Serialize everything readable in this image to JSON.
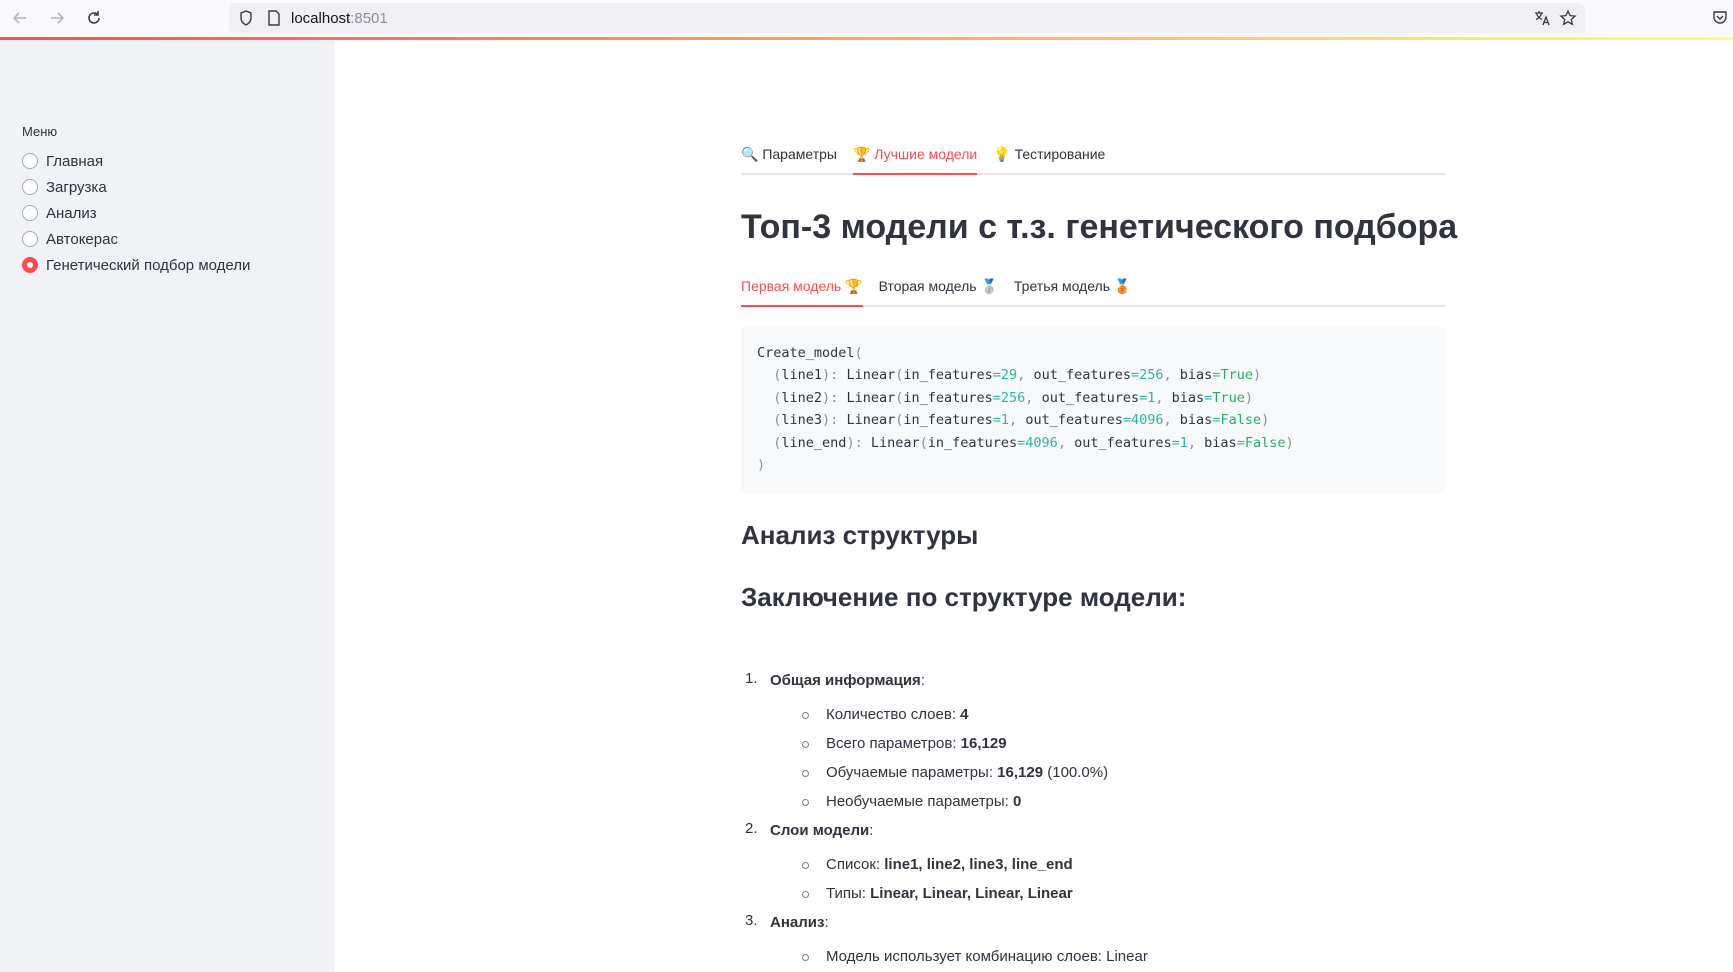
{
  "browser": {
    "url_host": "localhost",
    "url_port": ":8501"
  },
  "sidebar": {
    "label": "Меню",
    "items": [
      {
        "label": "Главная",
        "checked": false
      },
      {
        "label": "Загрузка",
        "checked": false
      },
      {
        "label": "Анализ",
        "checked": false
      },
      {
        "label": "Автокерас",
        "checked": false
      },
      {
        "label": "Генетический подбор модели",
        "checked": true
      }
    ]
  },
  "main": {
    "tabs": [
      {
        "icon": "🔍",
        "label": "Параметры",
        "active": false
      },
      {
        "icon": "🏆",
        "label": "Лучшие модели",
        "active": true
      },
      {
        "icon": "💡",
        "label": "Тестирование",
        "active": false
      }
    ],
    "title": "Топ-3 модели с т.з. генетического подбора",
    "model_tabs": [
      {
        "label": "Первая модель",
        "icon": "🏆",
        "active": true
      },
      {
        "label": "Вторая модель",
        "icon": "🥈",
        "active": false
      },
      {
        "label": "Третья модель",
        "icon": "🥉",
        "active": false
      }
    ],
    "code": {
      "header": "Create_model",
      "layers": [
        {
          "name": "line1",
          "type": "Linear",
          "in_features": "29",
          "out_features": "256",
          "bias": "True"
        },
        {
          "name": "line2",
          "type": "Linear",
          "in_features": "256",
          "out_features": "1",
          "bias": "True"
        },
        {
          "name": "line3",
          "type": "Linear",
          "in_features": "1",
          "out_features": "4096",
          "bias": "False"
        },
        {
          "name": "line_end",
          "type": "Linear",
          "in_features": "4096",
          "out_features": "1",
          "bias": "False"
        }
      ]
    },
    "analysis_heading": "Анализ структуры",
    "conclusion_heading": "Заключение по структуре модели:",
    "sections": [
      {
        "num": "1.",
        "title": "Общая информация",
        "items": [
          {
            "label": "Количество слоев: ",
            "value": "4",
            "extra": ""
          },
          {
            "label": "Всего параметров: ",
            "value": "16,129",
            "extra": ""
          },
          {
            "label": "Обучаемые параметры: ",
            "value": "16,129",
            "extra": " (100.0%)"
          },
          {
            "label": "Необучаемые параметры: ",
            "value": "0",
            "extra": ""
          }
        ]
      },
      {
        "num": "2.",
        "title": "Слои модели",
        "items": [
          {
            "label": "Список: ",
            "value": "line1, line2, line3, line_end",
            "extra": ""
          },
          {
            "label": "Типы: ",
            "value": "Linear, Linear, Linear, Linear",
            "extra": ""
          }
        ]
      },
      {
        "num": "3.",
        "title": "Анализ",
        "items": [
          {
            "label": "Модель использует комбинацию слоев: Linear",
            "value": "",
            "extra": ""
          }
        ]
      }
    ]
  },
  "colors": {
    "accent": "#ff4b4b",
    "sidebar_bg": "#f0f2f6",
    "text": "#31333f"
  }
}
